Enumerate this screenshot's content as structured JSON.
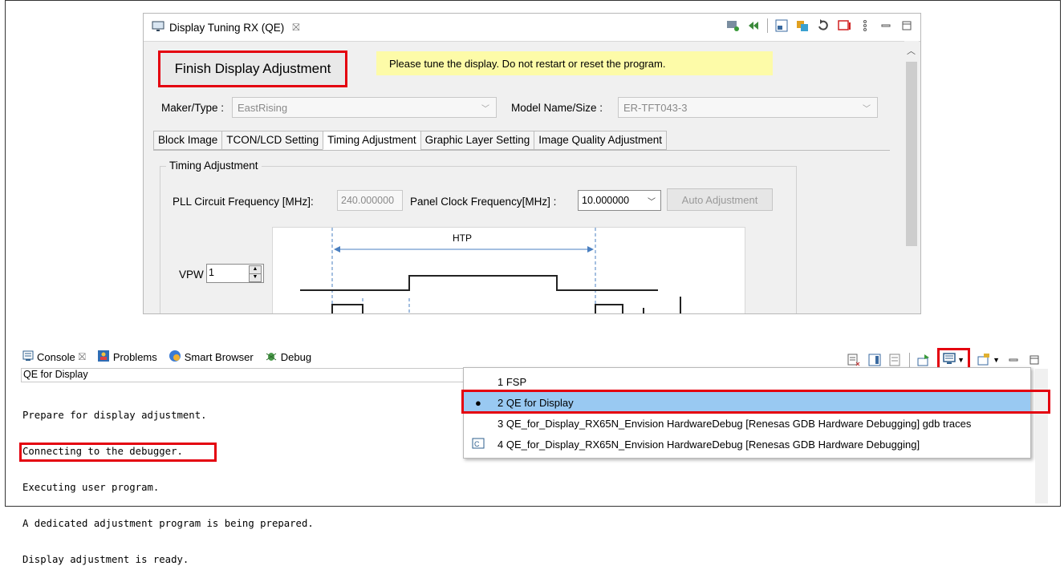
{
  "qe_panel": {
    "tab_title": "Display Tuning RX (QE)",
    "finish_button": "Finish Display Adjustment",
    "notice": "Please tune the display. Do not restart or reset the program.",
    "maker_label": "Maker/Type :",
    "maker_value": "EastRising",
    "model_label": "Model Name/Size :",
    "model_value": "ER-TFT043-3",
    "tabs": [
      "Block Image",
      "TCON/LCD Setting",
      "Timing Adjustment",
      "Graphic Layer Setting",
      "Image Quality Adjustment"
    ],
    "active_tab": "Timing Adjustment",
    "group_title": "Timing Adjustment",
    "pll_label": "PLL Circuit Frequency [MHz]:",
    "pll_value": "240.000000",
    "panel_clock_label": "Panel Clock Frequency[MHz] :",
    "panel_clock_value": "10.000000",
    "auto_button": "Auto Adjustment",
    "diagram_label": "HTP",
    "vpw_label": "VPW",
    "vpw_value": "1"
  },
  "console": {
    "tabs": [
      {
        "label": "Console",
        "icon": "console-icon"
      },
      {
        "label": "Problems",
        "icon": "problems-icon"
      },
      {
        "label": "Smart Browser",
        "icon": "smart-browser-icon"
      },
      {
        "label": "Debug",
        "icon": "debug-icon"
      }
    ],
    "header": "QE for Display",
    "lines": [
      "Prepare for display adjustment.",
      "Connecting to the debugger.",
      "Executing user program.",
      "A dedicated adjustment program is being prepared.",
      "Display adjustment is ready."
    ]
  },
  "console_menu": {
    "items": [
      "1 FSP",
      "2 QE for Display",
      "3 QE_for_Display_RX65N_Envision HardwareDebug [Renesas GDB Hardware Debugging] gdb traces",
      "4 QE_for_Display_RX65N_Envision HardwareDebug [Renesas GDB Hardware Debugging]"
    ],
    "selected_index": 1
  },
  "colors": {
    "highlight_red": "#e4000f",
    "notice_yellow": "#fdfba8",
    "menu_selected": "#99c9f2"
  }
}
